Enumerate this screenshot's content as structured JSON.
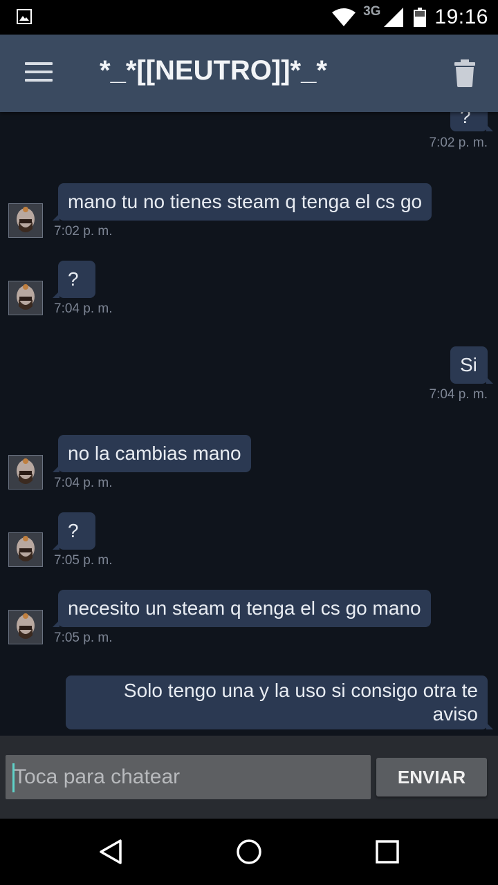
{
  "status_bar": {
    "network": "3G",
    "time": "19:16",
    "icons": [
      "image-notification-icon",
      "wifi-icon",
      "signal-icon",
      "battery-icon"
    ]
  },
  "app_bar": {
    "title": "*_*[[NEUTRO]]*_*",
    "icons": [
      "menu-icon",
      "trash-icon"
    ]
  },
  "messages": [
    {
      "direction": "out",
      "text": "?",
      "time": "7:02 p. m."
    },
    {
      "direction": "in",
      "text": "mano tu no tienes steam q tenga el cs go",
      "time": "7:02 p. m."
    },
    {
      "direction": "in",
      "text": "?",
      "time": "7:04 p. m."
    },
    {
      "direction": "out",
      "text": "Si",
      "time": "7:04 p. m."
    },
    {
      "direction": "in",
      "text": "no la cambias mano",
      "time": "7:04 p. m."
    },
    {
      "direction": "in",
      "text": "?",
      "time": "7:05 p. m."
    },
    {
      "direction": "in",
      "text": "necesito un steam q tenga el cs go mano",
      "time": "7:05 p. m."
    },
    {
      "direction": "out",
      "text": "Solo tengo una y la uso si consigo otra te aviso",
      "time": ""
    }
  ],
  "composer": {
    "placeholder": "Toca para chatear",
    "value": "",
    "send_label": "ENVIAR"
  },
  "nav_bar": {
    "icons": [
      "back-icon",
      "home-icon",
      "recents-icon"
    ]
  },
  "colors": {
    "background": "#0f141c",
    "app_bar": "#3a4a60",
    "bubble": "#2b3952",
    "timestamp": "#7d8594"
  }
}
